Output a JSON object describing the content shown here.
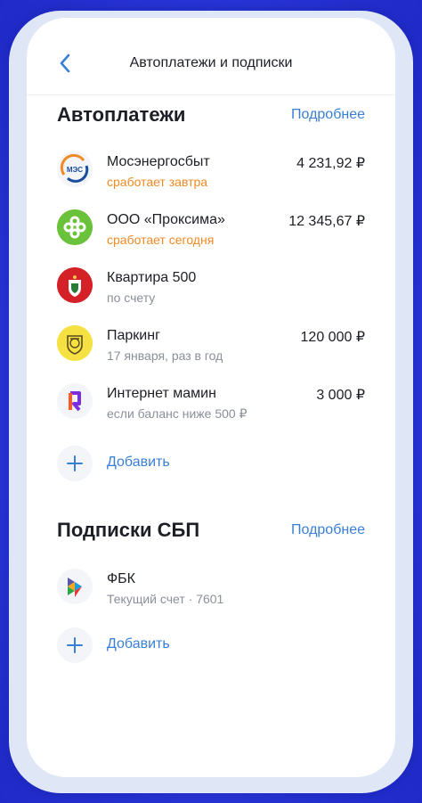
{
  "header": {
    "title": "Автоплатежи и подписки"
  },
  "autopayments": {
    "title": "Автоплатежи",
    "more_label": "Подробнее",
    "items": [
      {
        "name": "Мосэнергосбыт",
        "subtitle": "сработает завтра",
        "amount": "4 231,92 ₽",
        "logo_text": "МЭС"
      },
      {
        "name": "ООО «Проксима»",
        "subtitle": "сработает сегодня",
        "amount": "12 345,67 ₽"
      },
      {
        "name": "Квартира 500",
        "subtitle": "по счету",
        "amount": ""
      },
      {
        "name": "Паркинг",
        "subtitle": "17 января, раз в год",
        "amount": "120 000 ₽"
      },
      {
        "name": "Интернет мамин",
        "subtitle": "если баланс ниже 500 ₽",
        "amount": "3 000 ₽"
      }
    ],
    "add_label": "Добавить"
  },
  "sbp": {
    "title": "Подписки СБП",
    "more_label": "Подробнее",
    "items": [
      {
        "name": "ФБК",
        "subtitle": "Текущий счет · 7601"
      }
    ],
    "add_label": "Добавить"
  },
  "colors": {
    "accent": "#3a7fd6",
    "warning": "#f08a24",
    "text": "#1d1f26",
    "secondary_text": "#8a8f99",
    "background": "#2a35d8"
  },
  "icons": {
    "back": "chevron-left-icon",
    "add": "plus-icon"
  }
}
